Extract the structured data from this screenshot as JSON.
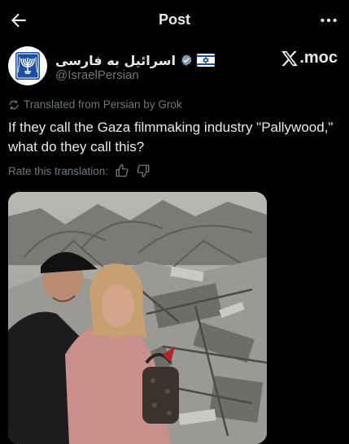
{
  "header": {
    "title": "Post"
  },
  "author": {
    "display_name": "اسرائیل به فارسی",
    "handle": "@IsraelPersian",
    "verified": true
  },
  "brand": {
    "logo_text": "com."
  },
  "translation": {
    "note": "Translated from Persian by Grok",
    "text": "If they call the Gaza filmmaking industry \"Pallywood,\" what do they call this?",
    "rate_label": "Rate this translation:"
  },
  "icons": [
    "arrow-left-icon",
    "more-horizontal-icon",
    "verified-badge-icon",
    "flag-icon",
    "x-logo-icon",
    "translate-icon",
    "thumbs-up-icon",
    "thumbs-down-icon"
  ],
  "colors": {
    "background": "#000000",
    "primary_text": "#e7e9ea",
    "secondary_text": "#71767b",
    "verified_badge": "#829aab"
  }
}
